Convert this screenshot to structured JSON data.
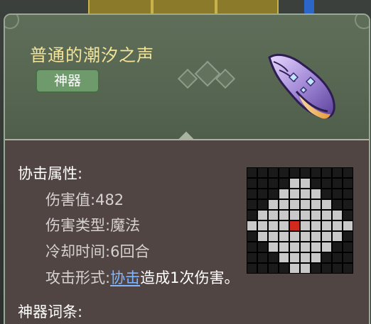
{
  "item": {
    "name": "普通的潮汐之声",
    "rarity": "神器",
    "icon": "purple-conch-shell-icon"
  },
  "attack": {
    "section_title": "协击属性:",
    "damage_label": "伤害值:",
    "damage_value": "482",
    "type_label": "伤害类型:",
    "type_value": "魔法",
    "cooldown_label": "冷却时间:",
    "cooldown_value": "6回合",
    "form_label": "攻击形式:",
    "form_link": "协击",
    "form_suffix": "造成1次伤害。"
  },
  "range_grid": {
    "rows": [
      "0000000000",
      "0000110000",
      "0001111000",
      "0011111100",
      "0111111110",
      "1111211111",
      "0111111110",
      "0011111100",
      "0001111000",
      "0000110000"
    ]
  },
  "artifact_section": {
    "title": "神器词条:"
  },
  "colors": {
    "name_gold": "#f3e49a",
    "badge_green": "#6f9a6c",
    "header_green": "#5e6e59",
    "body_brown": "#514543",
    "link_blue": "#7fb6ff",
    "grid_cell": "#c9c9c9",
    "grid_center": "#d02a1e",
    "grid_empty": "#000000"
  }
}
